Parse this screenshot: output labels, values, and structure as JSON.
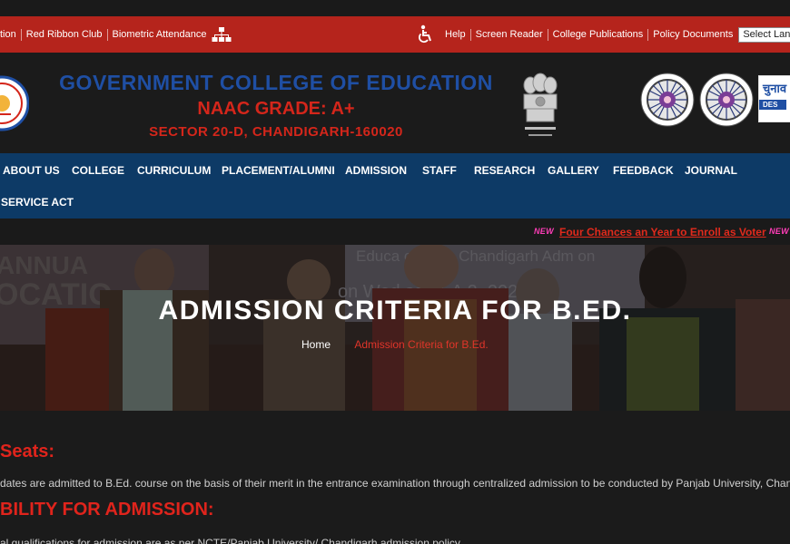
{
  "utility_bar": {
    "left_links": [
      "tion",
      "Red Ribbon Club",
      "Biometric Attendance"
    ],
    "right_links": [
      "Help",
      "Screen Reader",
      "College Publications",
      "Policy Documents"
    ],
    "language_select": "Select Language",
    "icons": {
      "sitemap": "sitemap-icon",
      "accessibility": "wheelchair-icon"
    }
  },
  "header": {
    "college_name": "GOVERNMENT COLLEGE OF EDUCATION",
    "naac": "NAAC GRADE: A+",
    "address": "SECTOR 20-D, CHANDIGARH-160020",
    "eci_logo_text": "चुनाव",
    "eci_logo_sub": "DES"
  },
  "nav": {
    "items": [
      "ABOUT US",
      "COLLEGE",
      "CURRICULUM",
      "PLACEMENT/ALUMNI",
      "ADMISSION",
      "STAFF",
      "RESEARCH",
      "GALLERY",
      "FEEDBACK",
      "JOURNAL",
      "SERVICE ACT"
    ]
  },
  "ticker": {
    "badge": "NEW",
    "text": "Four Chances an Year to Enroll as Voter"
  },
  "banner": {
    "title": "ADMISSION CRITERIA FOR B.ED.",
    "breadcrumb_home": "Home",
    "breadcrumb_current": "Admission Criteria for B.Ed.",
    "photo_text_1": "ANNUA",
    "photo_text_2": "OCATIO",
    "photo_text_3": "Educa    cretary, Chandigarh Adm    on",
    "photo_text_4": "on Wed  sday, A   2, 2023     am"
  },
  "content": {
    "seats_heading": "Seats:",
    "seats_text": "dates are admitted to B.Ed. course on the basis of their merit in the entrance examination through centralized admission to be conducted by Panjab University, Chandigarh",
    "eligibility_heading": "BILITY FOR ADMISSION:",
    "eligibility_text": "al qualifications for admission are as per NCTE/Panjab University/ Chandigarh admission policy."
  },
  "colors": {
    "utility_bar": "#b5241c",
    "nav": "#0d3a66",
    "heading_red": "#e0241c",
    "college_blue": "#1f4fa4"
  }
}
